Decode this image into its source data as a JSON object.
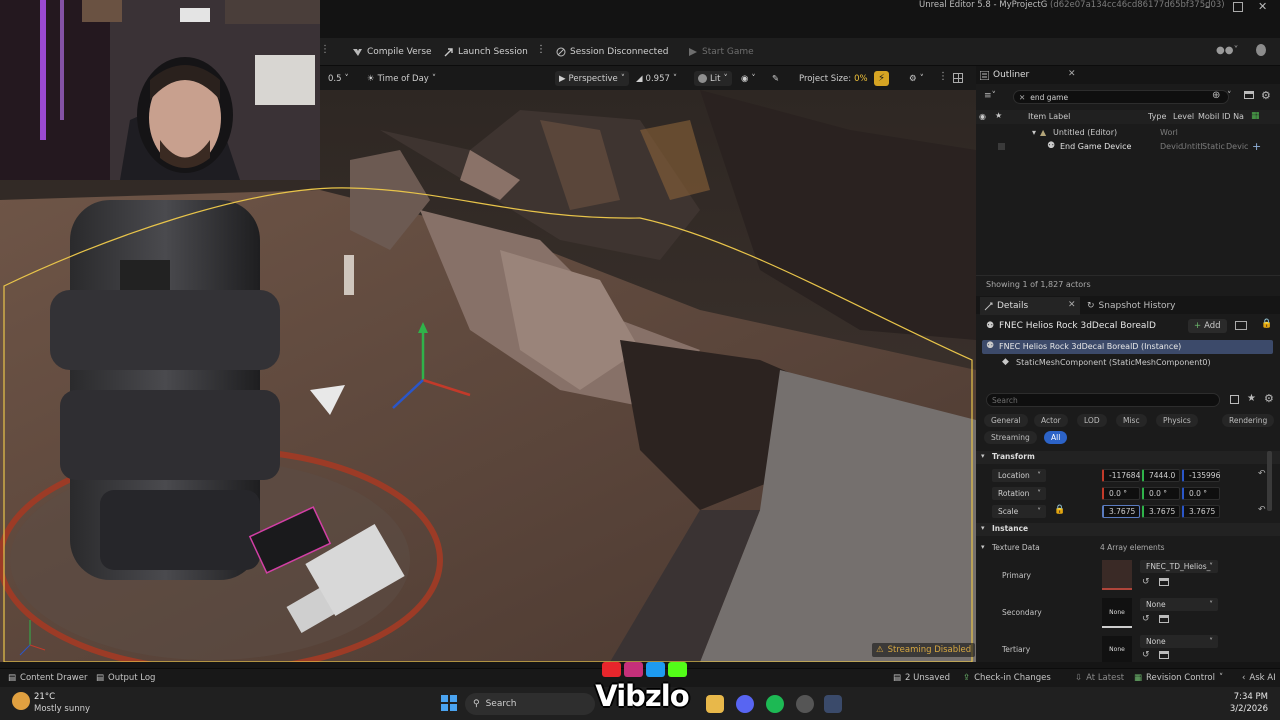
{
  "window": {
    "title": "Unreal Editor 5.8 - MyProjectG",
    "build_id": "(d62e07a134cc46cd86177d65bf375d03)"
  },
  "toolbar": {
    "compile_verse": "Compile Verse",
    "launch_session": "Launch Session",
    "session_status": "Session Disconnected",
    "start_game": "Start Game"
  },
  "viewport_toolbar": {
    "speed": "0.5",
    "time_of_day": "Time of Day",
    "perspective": "Perspective",
    "fov": "0.957",
    "lit": "Lit",
    "project_size_label": "Project Size:",
    "project_size_value": "0%"
  },
  "viewport": {
    "streaming_status": "Streaming Disabled",
    "selection_color": "#e8c44a"
  },
  "outliner": {
    "tab_label": "Outliner",
    "search_value": "end game",
    "columns": [
      "Item Label",
      "Type",
      "Level",
      "Mobil",
      "ID Na"
    ],
    "rows": [
      {
        "label": "Untitled (Editor)",
        "type": "Worl"
      },
      {
        "label": "End Game Device",
        "type": "Devic",
        "level": "Untitl",
        "mobility": "Static",
        "id": "Devic"
      }
    ],
    "status": "Showing 1 of 1,827 actors"
  },
  "details": {
    "tab_label": "Details",
    "snapshot_tab": "Snapshot History",
    "actor_name": "FNEC Helios Rock 3dDecal BorealD",
    "add_label": "Add",
    "instance_row": "FNEC Helios Rock 3dDecal BorealD (Instance)",
    "component_row": "StaticMeshComponent (StaticMeshComponent0)",
    "search_placeholder": "Search",
    "filters": [
      "General",
      "Actor",
      "LOD",
      "Misc",
      "Physics",
      "Rendering",
      "Streaming",
      "All"
    ],
    "transform_header": "Transform",
    "location_label": "Location",
    "location": [
      "-117684",
      "7444.0",
      "-135996"
    ],
    "rotation_label": "Rotation",
    "rotation": [
      "0.0 °",
      "0.0 °",
      "0.0 °"
    ],
    "scale_label": "Scale",
    "scale": [
      "3.7675",
      "3.7675",
      "3.7675"
    ],
    "instance_header": "Instance",
    "texture_data_label": "Texture Data",
    "texture_data_count": "4 Array elements",
    "primary_label": "Primary",
    "primary_value": "FNEC_TD_Helios_",
    "secondary_label": "Secondary",
    "secondary_value": "None",
    "secondary_thumb": "None",
    "tertiary_label": "Tertiary",
    "tertiary_value": "None",
    "tertiary_thumb": "None"
  },
  "bottom_bar": {
    "content_drawer": "Content Drawer",
    "output_log": "Output Log",
    "unsaved": "2 Unsaved",
    "check_in": "Check-in Changes",
    "at_latest": "At Latest",
    "revision_control": "Revision Control",
    "ask_ai": "Ask AI"
  },
  "taskbar": {
    "weather_temp": "21°C",
    "weather_desc": "Mostly sunny",
    "search": "Search",
    "time": "7:34 PM",
    "date": "3/2/2026"
  },
  "watermark": {
    "brand": "Vibzlo"
  }
}
